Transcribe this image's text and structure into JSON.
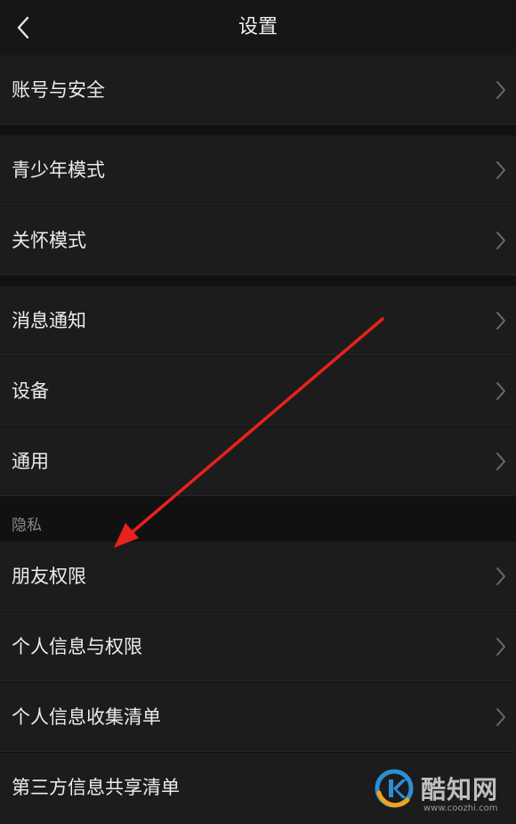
{
  "header": {
    "title": "设置",
    "back_icon": "chevron-left-icon"
  },
  "groups": [
    {
      "items": [
        {
          "label": "账号与安全"
        }
      ]
    },
    {
      "items": [
        {
          "label": "青少年模式"
        },
        {
          "label": "关怀模式"
        }
      ]
    },
    {
      "items": [
        {
          "label": "消息通知"
        },
        {
          "label": "设备"
        },
        {
          "label": "通用"
        }
      ]
    }
  ],
  "privacy": {
    "header": "隐私",
    "items": [
      {
        "label": "朋友权限"
      },
      {
        "label": "个人信息与权限"
      },
      {
        "label": "个人信息收集清单"
      },
      {
        "label": "第三方信息共享清单"
      }
    ]
  },
  "annotation": {
    "arrow_color": "#e8221c"
  },
  "watermark": {
    "name": "酷知网",
    "url": "www.coozhi.com"
  },
  "colors": {
    "background": "#111111",
    "row": "#1c1c1c",
    "text": "#ececec",
    "muted": "#8a8a8a"
  }
}
